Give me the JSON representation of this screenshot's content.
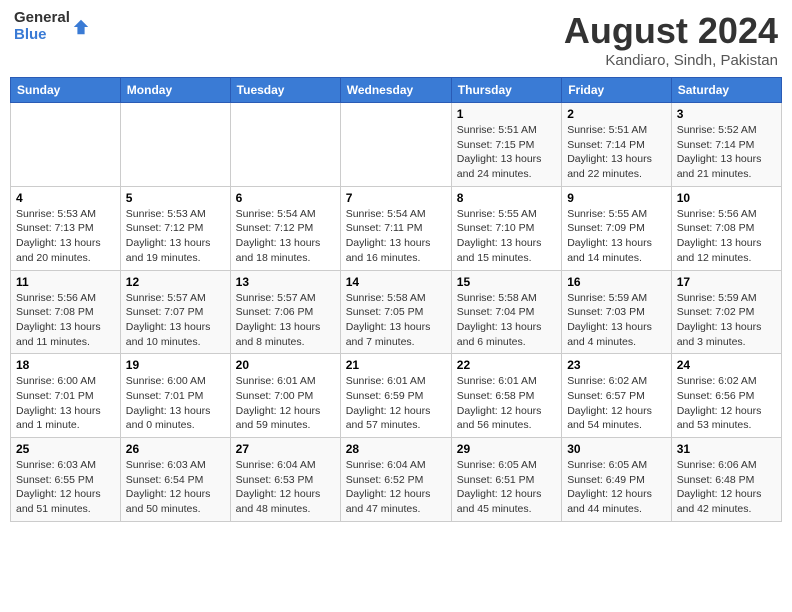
{
  "header": {
    "logo_general": "General",
    "logo_blue": "Blue",
    "main_title": "August 2024",
    "subtitle": "Kandiaro, Sindh, Pakistan"
  },
  "calendar": {
    "days_of_week": [
      "Sunday",
      "Monday",
      "Tuesday",
      "Wednesday",
      "Thursday",
      "Friday",
      "Saturday"
    ],
    "weeks": [
      [
        {
          "day": "",
          "info": ""
        },
        {
          "day": "",
          "info": ""
        },
        {
          "day": "",
          "info": ""
        },
        {
          "day": "",
          "info": ""
        },
        {
          "day": "1",
          "info": "Sunrise: 5:51 AM\nSunset: 7:15 PM\nDaylight: 13 hours and 24 minutes."
        },
        {
          "day": "2",
          "info": "Sunrise: 5:51 AM\nSunset: 7:14 PM\nDaylight: 13 hours and 22 minutes."
        },
        {
          "day": "3",
          "info": "Sunrise: 5:52 AM\nSunset: 7:14 PM\nDaylight: 13 hours and 21 minutes."
        }
      ],
      [
        {
          "day": "4",
          "info": "Sunrise: 5:53 AM\nSunset: 7:13 PM\nDaylight: 13 hours and 20 minutes."
        },
        {
          "day": "5",
          "info": "Sunrise: 5:53 AM\nSunset: 7:12 PM\nDaylight: 13 hours and 19 minutes."
        },
        {
          "day": "6",
          "info": "Sunrise: 5:54 AM\nSunset: 7:12 PM\nDaylight: 13 hours and 18 minutes."
        },
        {
          "day": "7",
          "info": "Sunrise: 5:54 AM\nSunset: 7:11 PM\nDaylight: 13 hours and 16 minutes."
        },
        {
          "day": "8",
          "info": "Sunrise: 5:55 AM\nSunset: 7:10 PM\nDaylight: 13 hours and 15 minutes."
        },
        {
          "day": "9",
          "info": "Sunrise: 5:55 AM\nSunset: 7:09 PM\nDaylight: 13 hours and 14 minutes."
        },
        {
          "day": "10",
          "info": "Sunrise: 5:56 AM\nSunset: 7:08 PM\nDaylight: 13 hours and 12 minutes."
        }
      ],
      [
        {
          "day": "11",
          "info": "Sunrise: 5:56 AM\nSunset: 7:08 PM\nDaylight: 13 hours and 11 minutes."
        },
        {
          "day": "12",
          "info": "Sunrise: 5:57 AM\nSunset: 7:07 PM\nDaylight: 13 hours and 10 minutes."
        },
        {
          "day": "13",
          "info": "Sunrise: 5:57 AM\nSunset: 7:06 PM\nDaylight: 13 hours and 8 minutes."
        },
        {
          "day": "14",
          "info": "Sunrise: 5:58 AM\nSunset: 7:05 PM\nDaylight: 13 hours and 7 minutes."
        },
        {
          "day": "15",
          "info": "Sunrise: 5:58 AM\nSunset: 7:04 PM\nDaylight: 13 hours and 6 minutes."
        },
        {
          "day": "16",
          "info": "Sunrise: 5:59 AM\nSunset: 7:03 PM\nDaylight: 13 hours and 4 minutes."
        },
        {
          "day": "17",
          "info": "Sunrise: 5:59 AM\nSunset: 7:02 PM\nDaylight: 13 hours and 3 minutes."
        }
      ],
      [
        {
          "day": "18",
          "info": "Sunrise: 6:00 AM\nSunset: 7:01 PM\nDaylight: 13 hours and 1 minute."
        },
        {
          "day": "19",
          "info": "Sunrise: 6:00 AM\nSunset: 7:01 PM\nDaylight: 13 hours and 0 minutes."
        },
        {
          "day": "20",
          "info": "Sunrise: 6:01 AM\nSunset: 7:00 PM\nDaylight: 12 hours and 59 minutes."
        },
        {
          "day": "21",
          "info": "Sunrise: 6:01 AM\nSunset: 6:59 PM\nDaylight: 12 hours and 57 minutes."
        },
        {
          "day": "22",
          "info": "Sunrise: 6:01 AM\nSunset: 6:58 PM\nDaylight: 12 hours and 56 minutes."
        },
        {
          "day": "23",
          "info": "Sunrise: 6:02 AM\nSunset: 6:57 PM\nDaylight: 12 hours and 54 minutes."
        },
        {
          "day": "24",
          "info": "Sunrise: 6:02 AM\nSunset: 6:56 PM\nDaylight: 12 hours and 53 minutes."
        }
      ],
      [
        {
          "day": "25",
          "info": "Sunrise: 6:03 AM\nSunset: 6:55 PM\nDaylight: 12 hours and 51 minutes."
        },
        {
          "day": "26",
          "info": "Sunrise: 6:03 AM\nSunset: 6:54 PM\nDaylight: 12 hours and 50 minutes."
        },
        {
          "day": "27",
          "info": "Sunrise: 6:04 AM\nSunset: 6:53 PM\nDaylight: 12 hours and 48 minutes."
        },
        {
          "day": "28",
          "info": "Sunrise: 6:04 AM\nSunset: 6:52 PM\nDaylight: 12 hours and 47 minutes."
        },
        {
          "day": "29",
          "info": "Sunrise: 6:05 AM\nSunset: 6:51 PM\nDaylight: 12 hours and 45 minutes."
        },
        {
          "day": "30",
          "info": "Sunrise: 6:05 AM\nSunset: 6:49 PM\nDaylight: 12 hours and 44 minutes."
        },
        {
          "day": "31",
          "info": "Sunrise: 6:06 AM\nSunset: 6:48 PM\nDaylight: 12 hours and 42 minutes."
        }
      ]
    ]
  }
}
